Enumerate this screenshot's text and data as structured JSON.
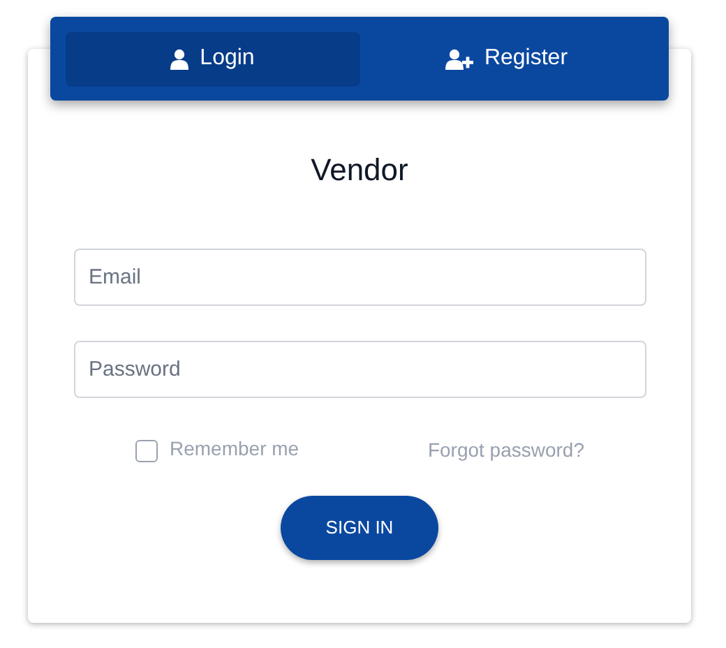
{
  "tabs": [
    {
      "label": "Login",
      "kind": "user",
      "selected": true
    },
    {
      "label": "Register",
      "kind": "user-plus",
      "selected": false
    }
  ],
  "title": "Vendor",
  "fields": [
    {
      "placeholder": "Email"
    },
    {
      "placeholder": "Password"
    }
  ],
  "remember_me": {
    "label": "Remember me",
    "checked": false
  },
  "forgot_link": "Forgot password?",
  "submit_button": "SIGN IN"
}
